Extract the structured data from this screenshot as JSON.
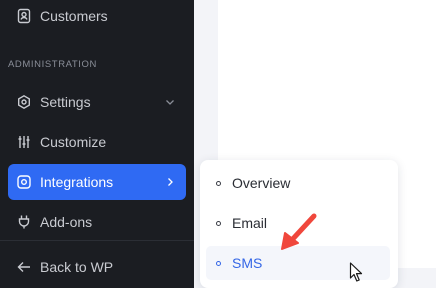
{
  "sidebar": {
    "items_top": [
      {
        "label": "Customers",
        "icon": "user-badge-icon"
      }
    ],
    "section_label": "ADMINISTRATION",
    "items": [
      {
        "label": "Settings",
        "icon": "gear-icon"
      },
      {
        "label": "Customize",
        "icon": "sliders-icon"
      },
      {
        "label": "Integrations",
        "icon": "integrations-gear-icon"
      },
      {
        "label": "Add-ons",
        "icon": "plug-icon"
      }
    ],
    "back_label": "Back to WP"
  },
  "submenu": {
    "items": [
      {
        "label": "Overview"
      },
      {
        "label": "Email"
      },
      {
        "label": "SMS"
      }
    ]
  },
  "colors": {
    "sidebar_bg": "#1b1d22",
    "active_bg": "#2f6af3",
    "submenu_active_text": "#3466e6",
    "annotation_arrow": "#f0473c"
  }
}
